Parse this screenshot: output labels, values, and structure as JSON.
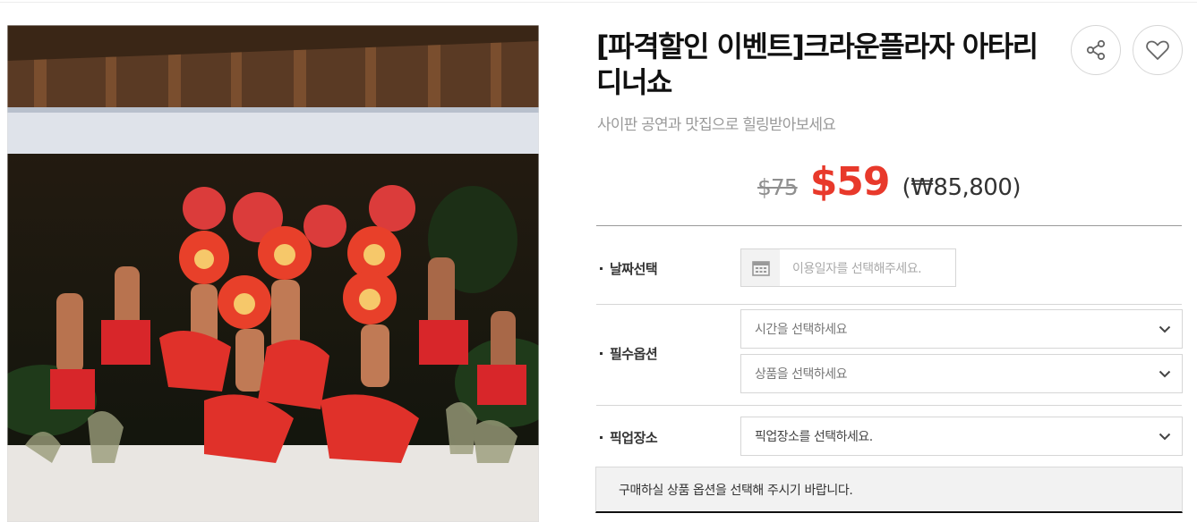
{
  "product": {
    "title": "[파격할인 이벤트]크라운플라자 아타리 디너쇼",
    "subtitle": "사이판 공연과 맛집으로 힐링받아보세요"
  },
  "price": {
    "original": "$75",
    "sale": "$59",
    "krw": "(₩85,800)"
  },
  "actions": {
    "share_icon": "share-icon",
    "like_icon": "heart-icon"
  },
  "options": {
    "date_label": "날짜선택",
    "date_placeholder": "이용일자를 선택해주세요.",
    "required_label": "필수옵션",
    "time_select": "시간을 선택하세요",
    "product_select": "상품을 선택하세요",
    "pickup_label": "픽업장소",
    "pickup_select": "픽업장소를 선택하세요."
  },
  "notice": "구매하실 상품 옵션을 선택해 주시기 바랍니다.",
  "colors": {
    "sale_price": "#e8392b",
    "border": "#d6d6d6",
    "notice_bg": "#f2f2f2"
  }
}
